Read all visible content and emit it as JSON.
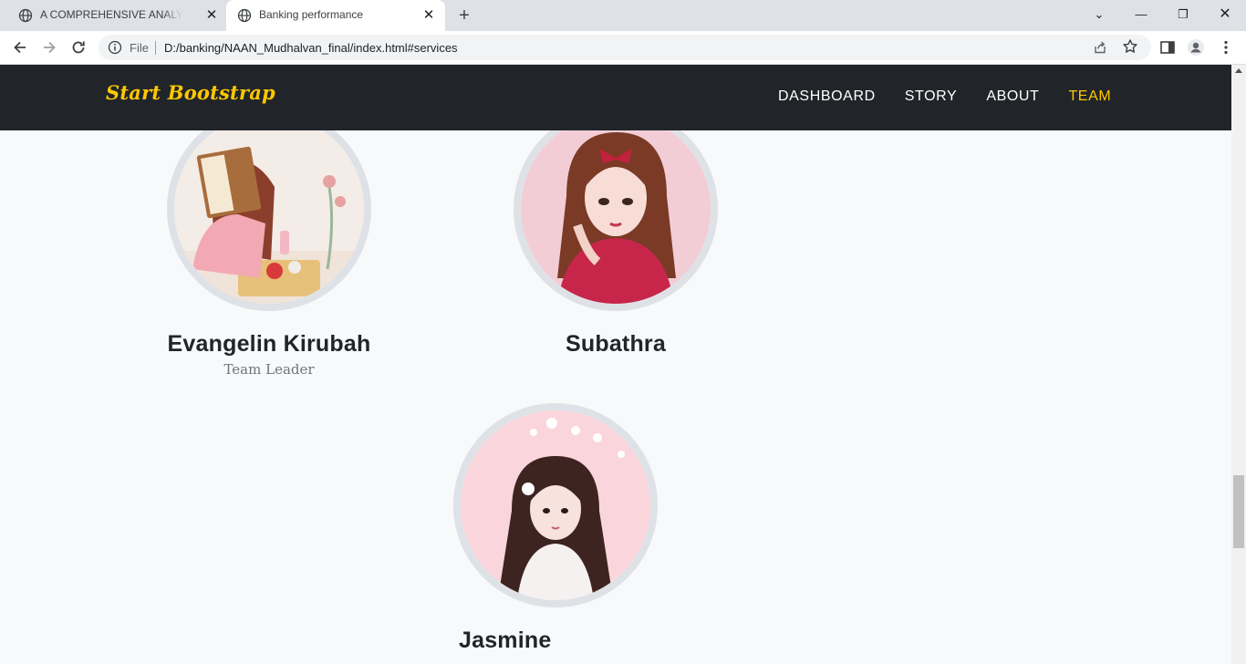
{
  "browser": {
    "tabs": [
      {
        "title": "A COMPREHENSIVE ANALYSIS OF",
        "active": false
      },
      {
        "title": "Banking performance",
        "active": true
      }
    ],
    "address": {
      "scheme_label": "File",
      "url": "D:/banking/NAAN_Mudhalvan_final/index.html#services"
    }
  },
  "navbar": {
    "brand": "Start Bootstrap",
    "links": [
      "Dashboard",
      "Story",
      "About",
      "Team"
    ],
    "active_link": "Team"
  },
  "team": {
    "members": [
      {
        "name": "Evangelin Kirubah",
        "role": "Team Leader"
      },
      {
        "name": "Subathra",
        "role": ""
      },
      {
        "name": "Jasmine",
        "role": ""
      }
    ]
  },
  "colors": {
    "navbar_bg": "#212529",
    "accent": "#ffc800",
    "page_bg": "#f8f9fa",
    "avatar_border": "#dee2e6"
  },
  "icons": [
    "globe-icon",
    "close-icon",
    "new-tab-icon",
    "back-icon",
    "forward-icon",
    "reload-icon",
    "info-icon",
    "share-icon",
    "star-icon",
    "side-panel-icon",
    "profile-icon",
    "menu-icon"
  ]
}
